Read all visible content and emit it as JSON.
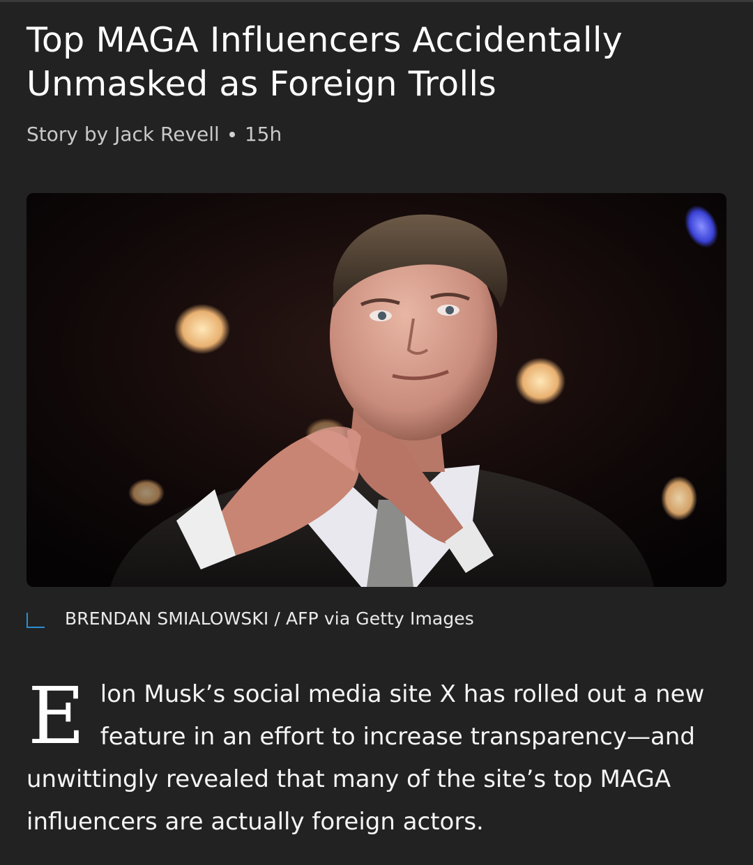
{
  "article": {
    "headline_line1": "Top MAGA Influencers Accidentally",
    "headline_line2": "Unmasked as Foreign Trolls",
    "byline_author": "Story by Jack Revell",
    "byline_time": "15h"
  },
  "image": {
    "subject": "photo of a man in a dark suit with hands clasped, bokeh stage lights behind",
    "caption": "BRENDAN SMIALOWSKI / AFP via Getty Images",
    "caption_icon": "corner-bracket-icon"
  },
  "body": {
    "drop_cap": "E",
    "text": "lon Musk’s social media site X has rolled out a new feature in an effort to increase transparency—and unwittingly revealed that many of the site’s top MAGA influencers are actually foreign actors."
  },
  "colors": {
    "background": "#222222",
    "accent": "#2a8fd6"
  }
}
